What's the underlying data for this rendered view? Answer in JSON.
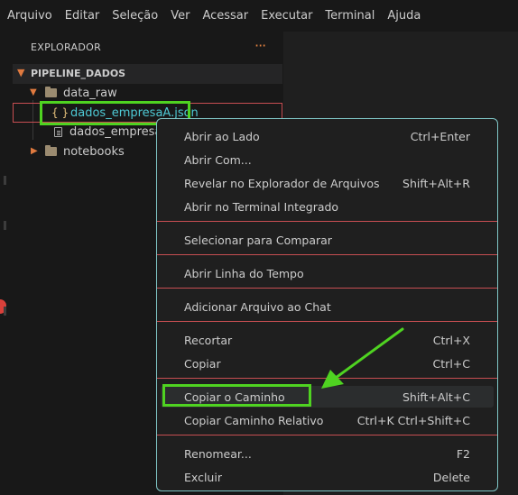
{
  "menubar": {
    "items": [
      "Arquivo",
      "Editar",
      "Seleção",
      "Ver",
      "Acessar",
      "Executar",
      "Terminal",
      "Ajuda"
    ]
  },
  "explorer": {
    "title": "EXPLORADOR",
    "section": "PIPELINE_DADOS",
    "tree": {
      "folder_data_raw": "data_raw",
      "file_a": "dados_empresaA.json",
      "file_b": "dados_empresaB",
      "folder_notebooks": "notebooks"
    }
  },
  "context_menu": {
    "groups": [
      [
        {
          "label": "Abrir ao Lado",
          "shortcut": "Ctrl+Enter"
        },
        {
          "label": "Abrir Com...",
          "shortcut": ""
        },
        {
          "label": "Revelar no Explorador de Arquivos",
          "shortcut": "Shift+Alt+R"
        },
        {
          "label": "Abrir no Terminal Integrado",
          "shortcut": ""
        }
      ],
      [
        {
          "label": "Selecionar para Comparar",
          "shortcut": ""
        }
      ],
      [
        {
          "label": "Abrir Linha do Tempo",
          "shortcut": ""
        }
      ],
      [
        {
          "label": "Adicionar Arquivo ao Chat",
          "shortcut": ""
        }
      ],
      [
        {
          "label": "Recortar",
          "shortcut": "Ctrl+X"
        },
        {
          "label": "Copiar",
          "shortcut": "Ctrl+C"
        }
      ],
      [
        {
          "label": "Copiar o Caminho",
          "shortcut": "Shift+Alt+C"
        },
        {
          "label": "Copiar Caminho Relativo",
          "shortcut": "Ctrl+K Ctrl+Shift+C"
        }
      ],
      [
        {
          "label": "Renomear...",
          "shortcut": "F2"
        },
        {
          "label": "Excluir",
          "shortcut": "Delete"
        }
      ]
    ]
  },
  "colors": {
    "highlight_box": "#4fd321",
    "separator": "#c74e52",
    "menu_border": "#7fc6c6",
    "selected_file_text": "#4ec9d4"
  },
  "icons": [
    "more-icon",
    "chevron-down-icon",
    "chevron-right-icon",
    "folder-icon",
    "json-file-icon",
    "file-icon"
  ]
}
